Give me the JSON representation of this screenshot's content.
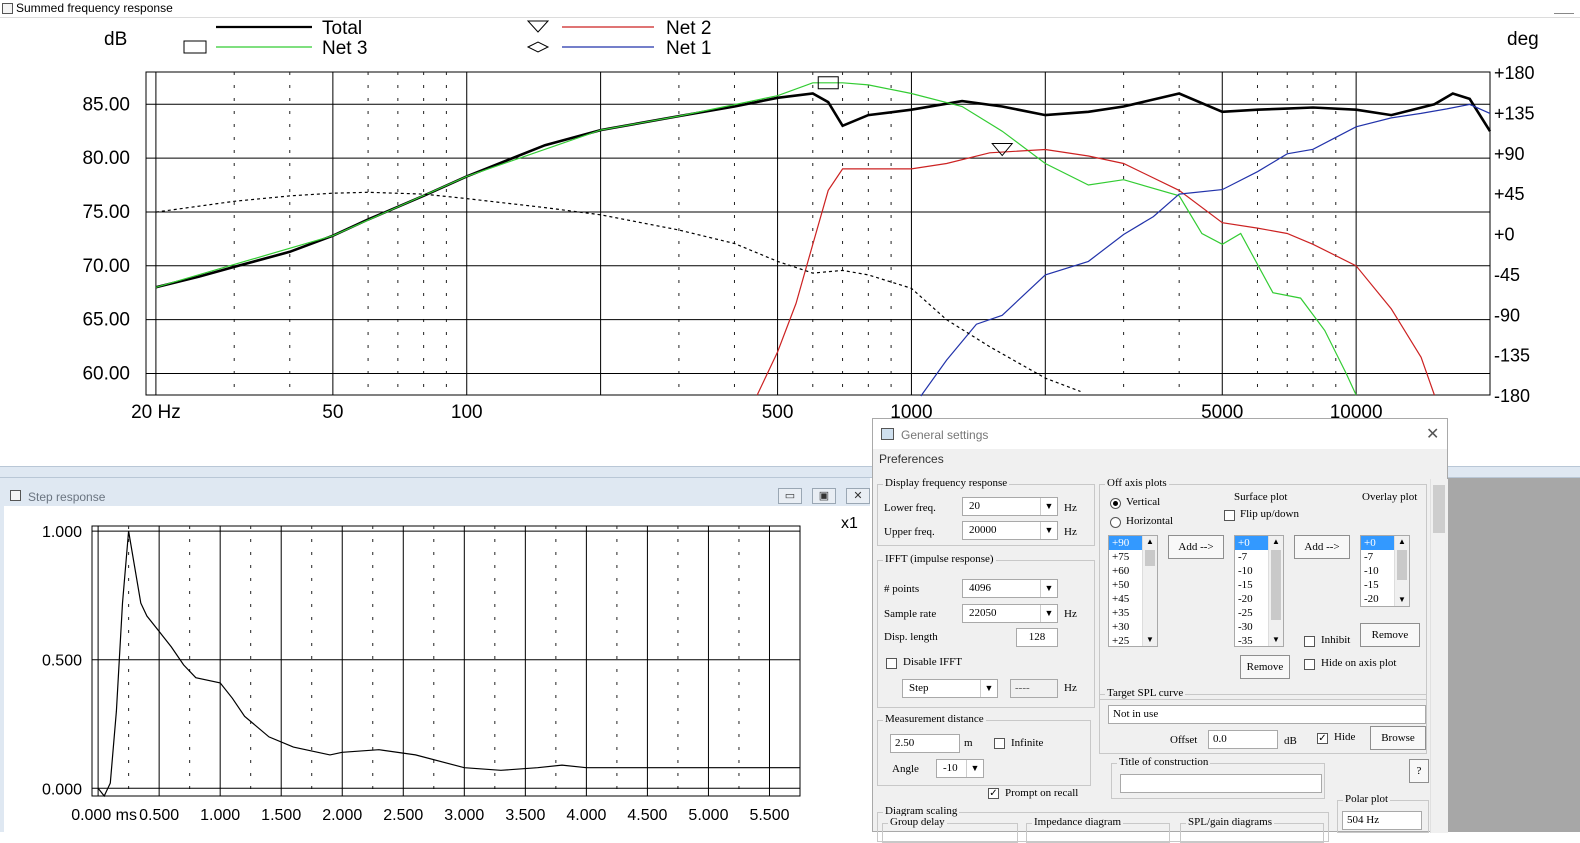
{
  "freq_window": {
    "title": "Summed frequency response",
    "left_unit": "dB",
    "right_unit": "deg",
    "legend": [
      {
        "label": "Total",
        "color": "#000000",
        "marker": "none"
      },
      {
        "label": "Net 3",
        "color": "#33cc33",
        "marker": "rectangle"
      },
      {
        "label": "Net 2",
        "color": "#cc2222",
        "marker": "triangle-down"
      },
      {
        "label": "Net 1",
        "color": "#2233aa",
        "marker": "diamond"
      }
    ]
  },
  "step_window": {
    "title": "Step response",
    "scale_label": "x1",
    "buttons": {
      "minimize": "▭",
      "restore": "▣",
      "close": "✕"
    }
  },
  "chart_data": [
    {
      "type": "line",
      "x_scale": "log",
      "x_ticks": [
        "20 Hz",
        "50",
        "100",
        "500",
        "1000",
        "5000",
        "10000"
      ],
      "x_tick_values": [
        20,
        50,
        100,
        500,
        1000,
        5000,
        10000
      ],
      "xlim": [
        19,
        20000
      ],
      "ylabel": "dB",
      "y_ticks": [
        "85.00",
        "80.00",
        "75.00",
        "70.00",
        "65.00",
        "60.00"
      ],
      "ylim": [
        58,
        88
      ],
      "y2label": "deg",
      "y2_ticks": [
        "+180",
        "+135",
        "+90",
        "+45",
        "+0",
        "-45",
        "-90",
        "-135",
        "-180"
      ],
      "y2lim": [
        -180,
        180
      ],
      "grid": true,
      "series": [
        {
          "name": "Total",
          "color": "#000000",
          "style": "solid-thick",
          "x": [
            20,
            25,
            30,
            40,
            50,
            60,
            80,
            100,
            150,
            200,
            300,
            400,
            500,
            600,
            650,
            700,
            800,
            1000,
            1300,
            1600,
            2000,
            2500,
            3000,
            4000,
            5000,
            6000,
            7000,
            8000,
            10000,
            12000,
            15000,
            16500,
            18000,
            20000
          ],
          "y": [
            68.0,
            69.0,
            69.9,
            71.3,
            72.8,
            74.3,
            76.5,
            78.3,
            81.2,
            82.6,
            83.9,
            84.8,
            85.6,
            86.0,
            85.2,
            83.0,
            84.0,
            84.5,
            85.3,
            84.8,
            84.0,
            84.3,
            84.8,
            86.0,
            84.3,
            84.5,
            84.6,
            84.7,
            84.5,
            84.0,
            85.0,
            86.0,
            85.5,
            82.5
          ]
        },
        {
          "name": "Net 3",
          "color": "#33cc33",
          "style": "solid",
          "x": [
            20,
            50,
            100,
            200,
            300,
            500,
            600,
            700,
            800,
            1000,
            1300,
            1600,
            2000,
            2500,
            3000,
            4000,
            4500,
            5000,
            5500,
            6500,
            7500,
            8500,
            9500,
            10000
          ],
          "y": [
            68.0,
            72.8,
            78.3,
            82.6,
            83.9,
            85.8,
            87.0,
            87.0,
            86.8,
            86.0,
            84.8,
            82.5,
            79.5,
            77.5,
            78.0,
            76.5,
            73.0,
            72.0,
            73.0,
            67.5,
            67.0,
            64.0,
            60.0,
            58.0
          ]
        },
        {
          "name": "Net 2",
          "color": "#cc2222",
          "style": "solid",
          "x": [
            450,
            500,
            550,
            600,
            650,
            700,
            800,
            1000,
            1200,
            1500,
            2000,
            2500,
            3000,
            4000,
            5000,
            6000,
            7000,
            8000,
            10000,
            12000,
            14000,
            15000
          ],
          "y": [
            58.0,
            62.0,
            66.5,
            72.0,
            77.0,
            79.0,
            79.0,
            79.0,
            79.5,
            80.5,
            80.8,
            80.2,
            79.5,
            77.0,
            74.0,
            73.5,
            73.0,
            72.0,
            70.0,
            66.0,
            61.5,
            58.0
          ]
        },
        {
          "name": "Net 1",
          "color": "#2233aa",
          "style": "solid",
          "y_axis": "right",
          "x": [
            1050,
            1200,
            1400,
            1600,
            2000,
            2500,
            3000,
            3500,
            4000,
            5000,
            6000,
            7000,
            8000,
            10000,
            12000,
            14000,
            16000,
            18000,
            20000
          ],
          "y": [
            -180,
            -140,
            -100,
            -90,
            -45,
            -30,
            0,
            20,
            45,
            50,
            70,
            90,
            95,
            120,
            130,
            135,
            140,
            145,
            135
          ]
        },
        {
          "name": "",
          "color": "#000000",
          "style": "dashed",
          "y_axis": "right",
          "x": [
            20,
            30,
            40,
            50,
            60,
            80,
            100,
            150,
            200,
            300,
            400,
            500,
            600,
            700,
            800,
            1000,
            1200,
            1500,
            2000,
            2400
          ],
          "y": [
            25,
            37,
            43,
            46,
            47,
            45,
            40,
            30,
            22,
            5,
            -10,
            -30,
            -43,
            -40,
            -45,
            -60,
            -95,
            -125,
            -160,
            -175
          ]
        }
      ]
    },
    {
      "type": "line",
      "x_ticks": [
        "0.000 ms",
        "0.500",
        "1.000",
        "1.500",
        "2.000",
        "2.500",
        "3.000",
        "3.500",
        "4.000",
        "4.500",
        "5.000",
        "5.500"
      ],
      "x_tick_values": [
        0,
        0.5,
        1.0,
        1.5,
        2.0,
        2.5,
        3.0,
        3.5,
        4.0,
        4.5,
        5.0,
        5.5
      ],
      "xlim": [
        -0.05,
        5.75
      ],
      "y_ticks": [
        "1.000",
        "0.500",
        "0.000"
      ],
      "y_tick_values": [
        1.0,
        0.5,
        0.0
      ],
      "ylim": [
        -0.03,
        1.02
      ],
      "grid": true,
      "series": [
        {
          "color": "#000000",
          "style": "solid",
          "x": [
            0.0,
            0.05,
            0.1,
            0.15,
            0.2,
            0.25,
            0.3,
            0.35,
            0.4,
            0.5,
            0.6,
            0.7,
            0.8,
            1.0,
            1.1,
            1.2,
            1.4,
            1.6,
            1.8,
            1.9,
            2.0,
            2.3,
            2.6,
            3.0,
            3.3,
            3.6,
            3.8,
            4.0,
            4.5,
            5.0,
            5.5,
            5.75
          ],
          "y": [
            0.0,
            -0.03,
            0.02,
            0.3,
            0.72,
            1.0,
            0.86,
            0.72,
            0.67,
            0.61,
            0.55,
            0.48,
            0.43,
            0.41,
            0.35,
            0.28,
            0.2,
            0.16,
            0.14,
            0.13,
            0.14,
            0.15,
            0.13,
            0.08,
            0.07,
            0.08,
            0.09,
            0.08,
            0.08,
            0.08,
            0.08,
            0.08
          ]
        }
      ]
    }
  ],
  "dialog": {
    "title": "General settings",
    "tab": "Preferences",
    "close": "✕",
    "display_freq": {
      "title": "Display frequency response",
      "lower_label": "Lower freq.",
      "lower_value": "20",
      "lower_unit": "Hz",
      "upper_label": "Upper freq.",
      "upper_value": "20000",
      "upper_unit": "Hz"
    },
    "ifft": {
      "title": "IFFT (impulse response)",
      "points_label": "# points",
      "points_value": "4096",
      "rate_label": "Sample rate",
      "rate_value": "22050",
      "rate_unit": "Hz",
      "disp_label": "Disp. length",
      "disp_value": "128",
      "disable_label": "Disable IFFT",
      "mode_value": "Step",
      "mode_freq": "----",
      "mode_unit": "Hz"
    },
    "measurement": {
      "title": "Measurement distance",
      "distance": "2.50",
      "distance_unit": "m",
      "infinite_label": "Infinite",
      "angle_label": "Angle",
      "angle_value": "-10"
    },
    "prompt_label": "Prompt on recall",
    "diagram_scaling": {
      "title": "Diagram scaling",
      "group_delay": "Group delay",
      "impedance": "Impedance diagram",
      "spl_gain": "SPL/gain diagrams"
    },
    "off_axis": {
      "title": "Off axis plots",
      "vertical_label": "Vertical",
      "horizontal_label": "Horizontal",
      "surface_label": "Surface plot",
      "overlay_label": "Overlay plot",
      "flip_label": "Flip up/down",
      "add_label": "Add -->",
      "add2_label": "Add -->",
      "remove_label": "Remove",
      "remove2_label": "Remove",
      "inhibit_label": "Inhibit",
      "hide_axis_label": "Hide on axis plot",
      "list_angles": [
        "+90",
        "+75",
        "+60",
        "+50",
        "+45",
        "+35",
        "+30",
        "+25"
      ],
      "surface_angles": [
        "+0",
        "-7",
        "-10",
        "-15",
        "-20",
        "-25",
        "-30",
        "-35"
      ],
      "overlay_angles": [
        "+0",
        "-7",
        "-10",
        "-15",
        "-20"
      ]
    },
    "target_spl": {
      "title": "Target SPL curve",
      "value": "Not in use",
      "offset_label": "Offset",
      "offset_value": "0.0",
      "offset_unit": "dB",
      "hide_label": "Hide",
      "browse_label": "Browse"
    },
    "construction": {
      "title": "Title of construction",
      "value": "",
      "help_label": "?"
    },
    "polar": {
      "title": "Polar plot",
      "value": "504 Hz"
    }
  }
}
